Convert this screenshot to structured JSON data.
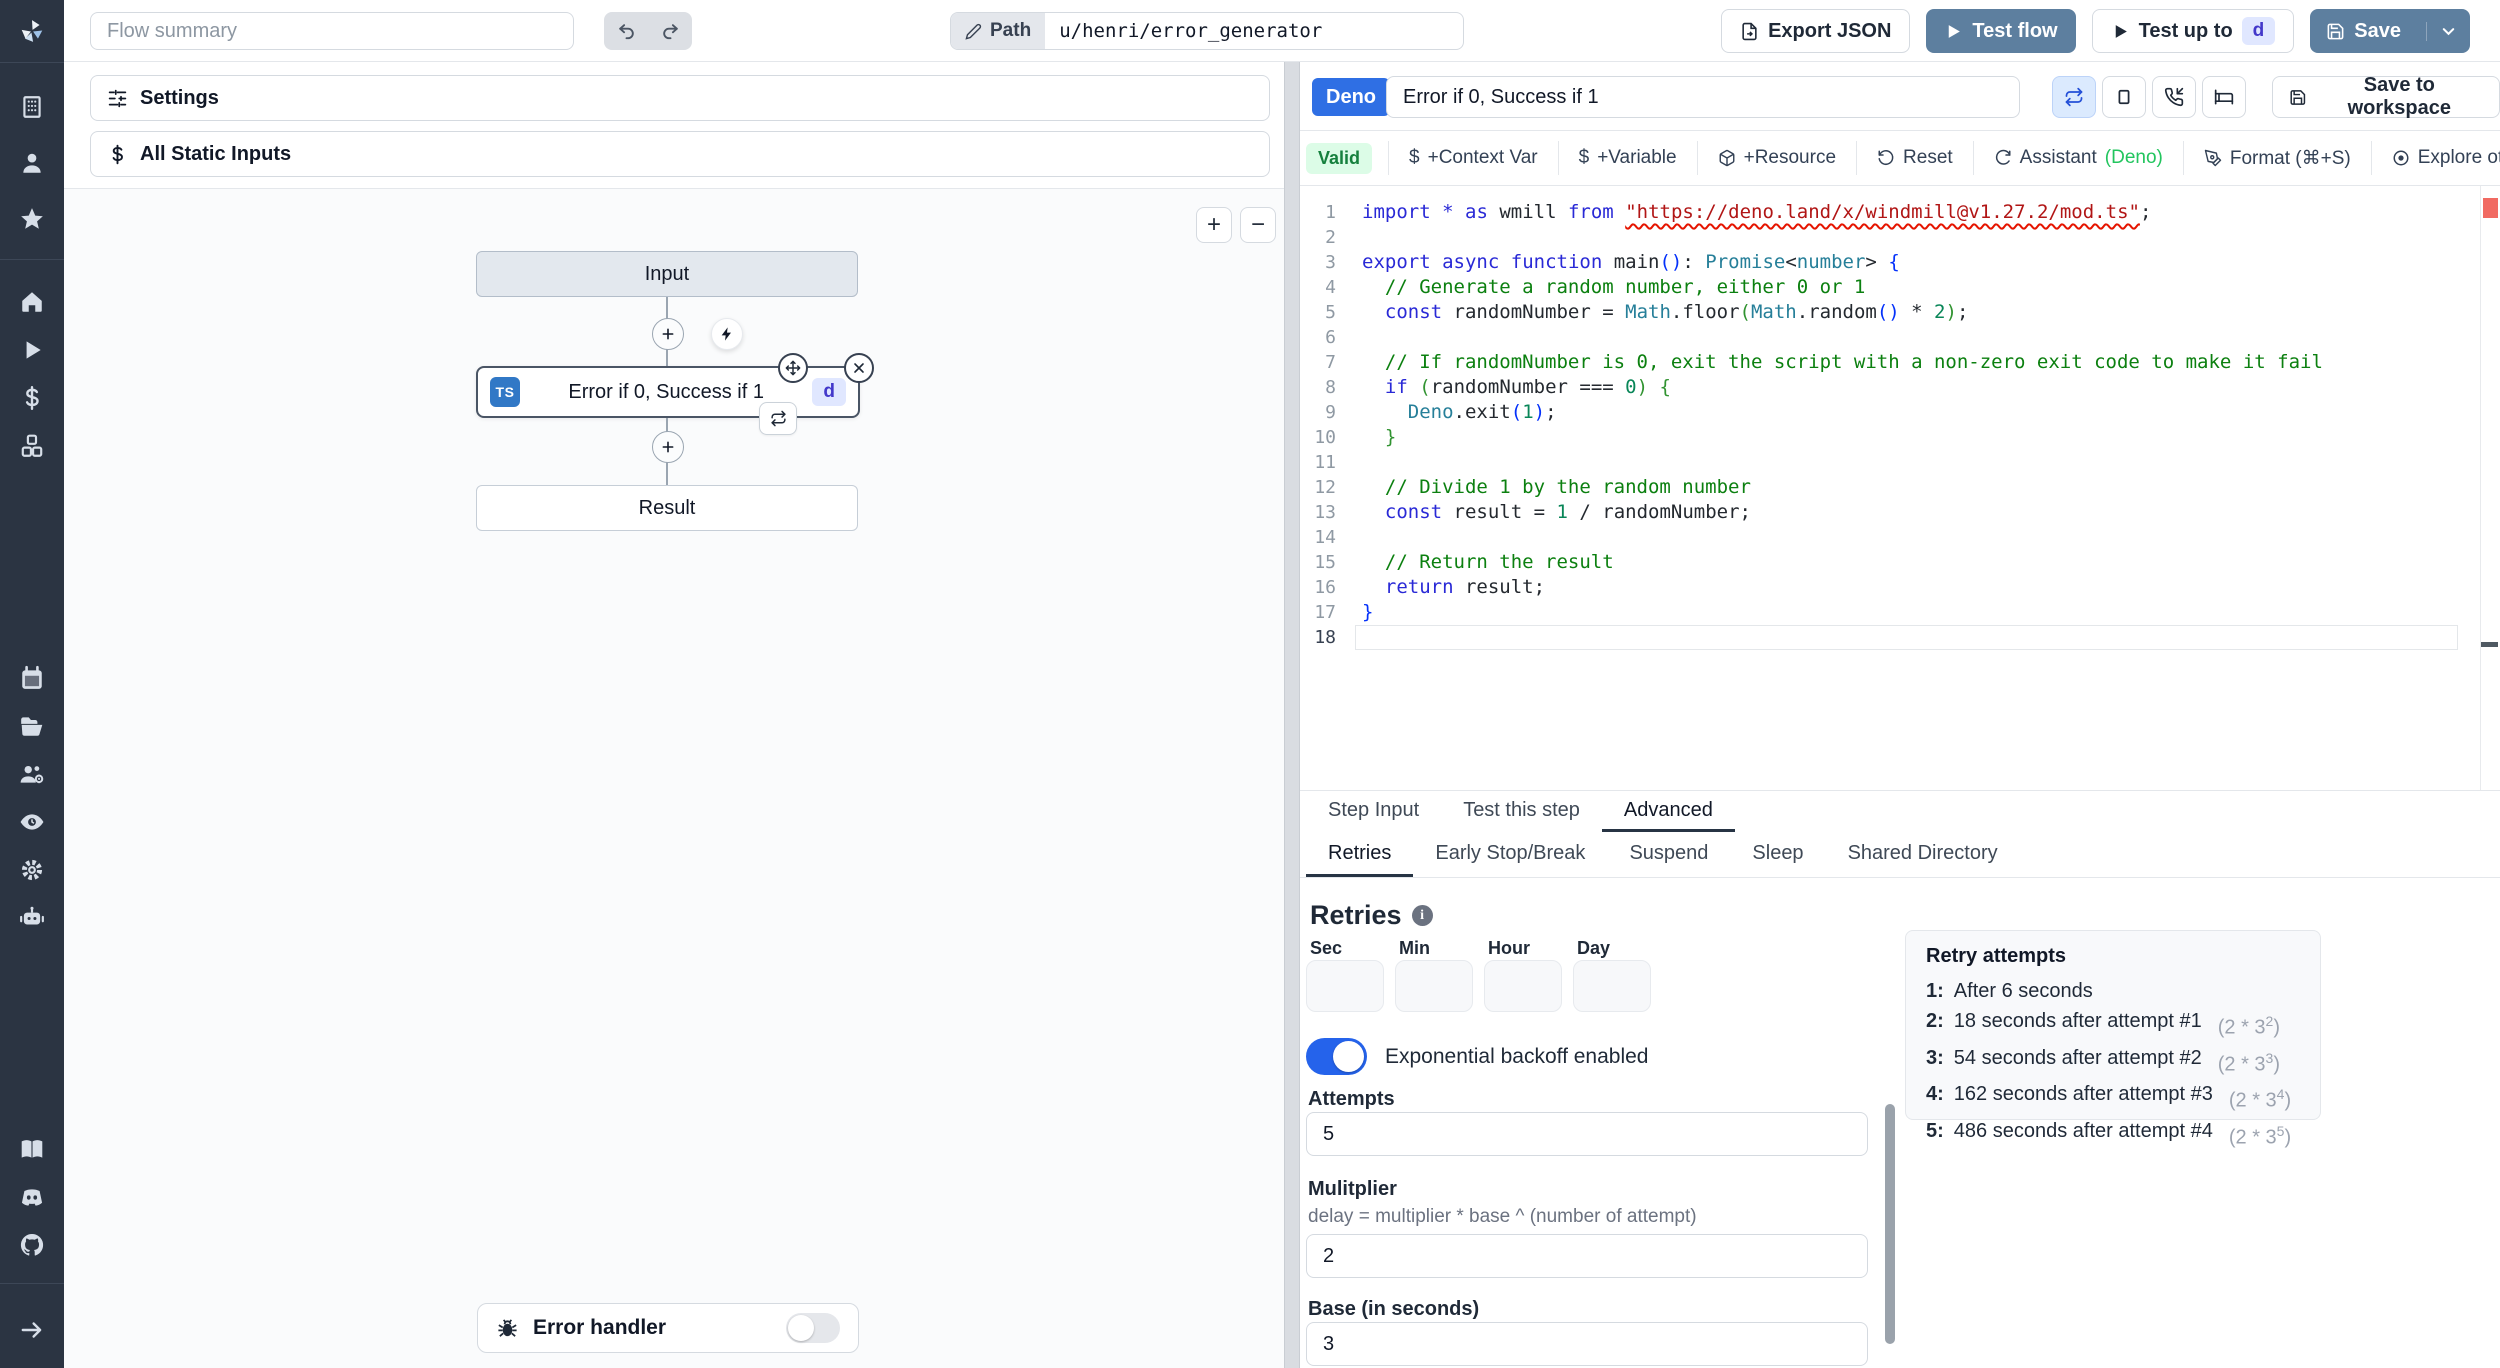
{
  "header": {
    "flow_summary_placeholder": "Flow summary",
    "path_label": "Path",
    "path_value": "u/henri/error_generator",
    "export_json": "Export JSON",
    "test_flow": "Test flow",
    "test_up_to": "Test up to",
    "test_up_to_badge": "d",
    "save": "Save"
  },
  "sidebar": {
    "icons": [
      "windmill-logo",
      "workspace",
      "user",
      "favorites",
      "home",
      "runs",
      "variables",
      "resources",
      "schedules",
      "folders",
      "groups",
      "audit-logs",
      "settings",
      "ai-assistant",
      "docs",
      "discord",
      "github",
      "expand-sidebar"
    ]
  },
  "left_panel": {
    "settings": "Settings",
    "all_static_inputs": "All Static Inputs",
    "zoom_in": "+",
    "zoom_out": "−",
    "nodes": {
      "input": "Input",
      "step_lang_badge": "TS",
      "step_title": "Error if 0, Success if 1",
      "step_id_badge": "d",
      "result": "Result",
      "error_handler": "Error handler"
    }
  },
  "right_panel": {
    "lang_badge": "Deno",
    "title_value": "Error if 0, Success if 1",
    "save_to_workspace": "Save to workspace",
    "toolbar": {
      "valid": "Valid",
      "context_var": "+Context Var",
      "variable": "+Variable",
      "resource": "+Resource",
      "reset": "Reset",
      "assistant": "Assistant",
      "assistant_lang": "(Deno)",
      "format": "Format (⌘+S)",
      "explore": "Explore other s"
    }
  },
  "editor": {
    "current_line": 18,
    "lines": [
      [
        [
          "k",
          "import"
        ],
        [
          "v",
          " "
        ],
        [
          "k",
          "*"
        ],
        [
          "v",
          " "
        ],
        [
          "k",
          "as"
        ],
        [
          "v",
          " wmill "
        ],
        [
          "k",
          "from"
        ],
        [
          "v",
          " "
        ],
        [
          "s sq",
          "\"https://deno.land/x/windmill@v1.27.2/mod.ts\""
        ],
        [
          "v",
          ";"
        ]
      ],
      [],
      [
        [
          "k",
          "export"
        ],
        [
          "v",
          " "
        ],
        [
          "k",
          "async"
        ],
        [
          "v",
          " "
        ],
        [
          "k",
          "function"
        ],
        [
          "v",
          " main"
        ],
        [
          "b1",
          "()"
        ],
        [
          "v",
          ": "
        ],
        [
          "t",
          "Promise"
        ],
        [
          "v",
          "<"
        ],
        [
          "t",
          "number"
        ],
        [
          "v",
          "> "
        ],
        [
          "b1",
          "{"
        ]
      ],
      [
        [
          "v",
          "  "
        ],
        [
          "c",
          "// Generate a random number, either 0 or 1"
        ]
      ],
      [
        [
          "v",
          "  "
        ],
        [
          "k",
          "const"
        ],
        [
          "v",
          " randomNumber = "
        ],
        [
          "t",
          "Math"
        ],
        [
          "v",
          ".floor"
        ],
        [
          "b2",
          "("
        ],
        [
          "t",
          "Math"
        ],
        [
          "v",
          ".random"
        ],
        [
          "b1",
          "()"
        ],
        [
          "v",
          " * "
        ],
        [
          "n",
          "2"
        ],
        [
          "b2",
          ")"
        ],
        [
          "v",
          ";"
        ]
      ],
      [],
      [
        [
          "v",
          "  "
        ],
        [
          "c",
          "// If randomNumber is 0, exit the script with a non-zero exit code to make it fail"
        ]
      ],
      [
        [
          "v",
          "  "
        ],
        [
          "k",
          "if"
        ],
        [
          "v",
          " "
        ],
        [
          "b2",
          "("
        ],
        [
          "v",
          "randomNumber === "
        ],
        [
          "n",
          "0"
        ],
        [
          "b2",
          ")"
        ],
        [
          "v",
          " "
        ],
        [
          "b2",
          "{"
        ]
      ],
      [
        [
          "v",
          "    "
        ],
        [
          "t",
          "Deno"
        ],
        [
          "v",
          ".exit"
        ],
        [
          "b1",
          "("
        ],
        [
          "n",
          "1"
        ],
        [
          "b1",
          ")"
        ],
        [
          "v",
          ";"
        ]
      ],
      [
        [
          "v",
          "  "
        ],
        [
          "b2",
          "}"
        ]
      ],
      [],
      [
        [
          "v",
          "  "
        ],
        [
          "c",
          "// Divide 1 by the random number"
        ]
      ],
      [
        [
          "v",
          "  "
        ],
        [
          "k",
          "const"
        ],
        [
          "v",
          " result = "
        ],
        [
          "n",
          "1"
        ],
        [
          "v",
          " / randomNumber;"
        ]
      ],
      [],
      [
        [
          "v",
          "  "
        ],
        [
          "c",
          "// Return the result"
        ]
      ],
      [
        [
          "v",
          "  "
        ],
        [
          "k",
          "return"
        ],
        [
          "v",
          " result;"
        ]
      ],
      [
        [
          "b1",
          "}"
        ]
      ],
      []
    ]
  },
  "tabs": {
    "primary": [
      {
        "label": "Step Input",
        "active": false
      },
      {
        "label": "Test this step",
        "active": false
      },
      {
        "label": "Advanced",
        "active": true
      }
    ],
    "secondary": [
      {
        "label": "Retries",
        "active": true
      },
      {
        "label": "Early Stop/Break",
        "active": false
      },
      {
        "label": "Suspend",
        "active": false
      },
      {
        "label": "Sleep",
        "active": false
      },
      {
        "label": "Shared Directory",
        "active": false
      }
    ]
  },
  "retries": {
    "heading": "Retries",
    "time_labels": [
      "Sec",
      "Min",
      "Hour",
      "Day"
    ],
    "backoff_label": "Exponential backoff enabled",
    "backoff_enabled": true,
    "attempts_label": "Attempts",
    "attempts_value": "5",
    "multiplier_label": "Mulitplier",
    "multiplier_help": "delay = multiplier * base ^ (number of attempt)",
    "multiplier_value": "2",
    "base_label": "Base (in seconds)",
    "base_value": "3"
  },
  "retry_attempts": {
    "title": "Retry attempts",
    "items": [
      {
        "num": "1:",
        "text": "After 6 seconds",
        "formula_base": "",
        "formula_exp": "",
        "formula_end": ""
      },
      {
        "num": "2:",
        "text": "18 seconds after attempt #1",
        "formula_base": "(2 * 3",
        "formula_exp": "2",
        "formula_end": ")"
      },
      {
        "num": "3:",
        "text": "54 seconds after attempt #2",
        "formula_base": "(2 * 3",
        "formula_exp": "3",
        "formula_end": ")"
      },
      {
        "num": "4:",
        "text": "162 seconds after attempt #3",
        "formula_base": "(2 * 3",
        "formula_exp": "4",
        "formula_end": ")"
      },
      {
        "num": "5:",
        "text": "486 seconds after attempt #4",
        "formula_base": "(2 * 3",
        "formula_exp": "5",
        "formula_end": ")"
      }
    ]
  }
}
